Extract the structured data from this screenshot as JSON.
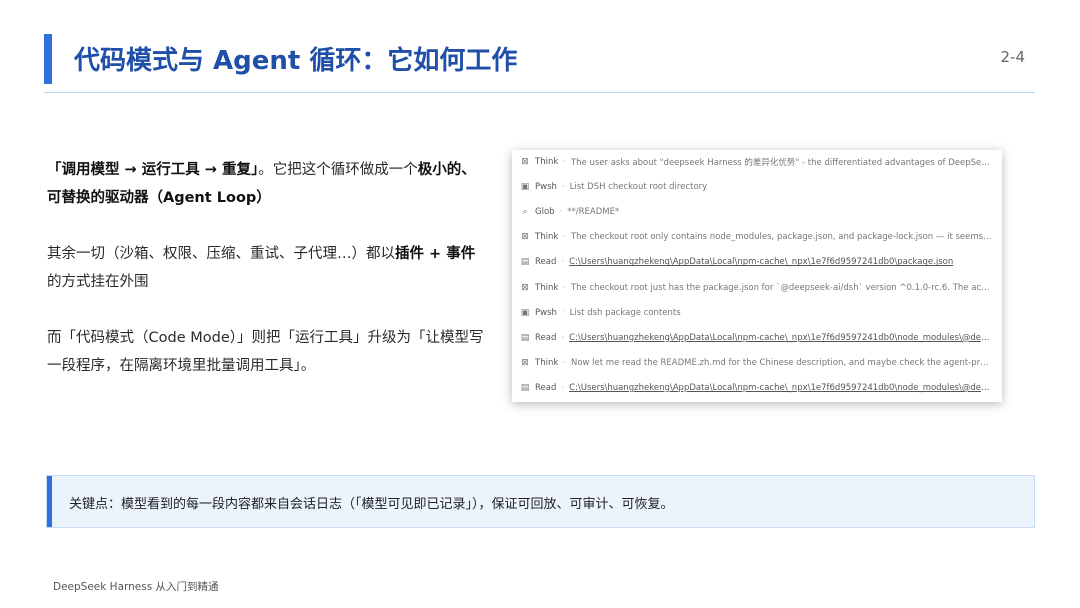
{
  "header": {
    "title": "代码模式与 Agent 循环：它如何工作",
    "page_number": "2-4"
  },
  "left": {
    "p1_bold": "「调用模型 → 运行工具 → 重复」",
    "p1_a": "。它把这个循环做成一个",
    "p1_bold2": "极小的、可替换的驱动器（Agent Loop）",
    "p2_a": "其余一切（沙箱、权限、压缩、重试、子代理…）都以",
    "p2_bold": "插件 + 事件",
    "p2_b": "的方式挂在外围",
    "p3": "而「代码模式（Code Mode）」则把「运行工具」升级为「让模型写一段程序，在隔离环境里批量调用工具」。"
  },
  "log": {
    "rows": [
      {
        "icon": "think-icon",
        "glyph": "⊠",
        "kind": "Think",
        "text": "The user asks about \"deepseek Harness 的差异化优势\" - the differentiated advantages of DeepSeek Harnes...",
        "path": false
      },
      {
        "icon": "terminal-icon",
        "glyph": "▣",
        "kind": "Pwsh",
        "text": "List DSH checkout root directory",
        "path": false
      },
      {
        "icon": "search-icon",
        "glyph": "⌕",
        "kind": "Glob",
        "text": "**/README*",
        "path": false
      },
      {
        "icon": "think-icon",
        "glyph": "⊠",
        "kind": "Think",
        "text": "The checkout root only contains node_modules, package.json, and package-lock.json — it seems the npx ca...",
        "path": false
      },
      {
        "icon": "file-icon",
        "glyph": "▤",
        "kind": "Read",
        "text": "C:\\Users\\huangzhekeng\\AppData\\Local\\npm-cache\\_npx\\1e7f6d9597241db0\\package.json",
        "path": true
      },
      {
        "icon": "think-icon",
        "glyph": "⊠",
        "kind": "Think",
        "text": "The checkout root just has the package.json for `@deepseek-ai/dsh` version ^0.1.0-rc.6. The actual DSH pac...",
        "path": false
      },
      {
        "icon": "terminal-icon",
        "glyph": "▣",
        "kind": "Pwsh",
        "text": "List dsh package contents",
        "path": false
      },
      {
        "icon": "file-icon",
        "glyph": "▤",
        "kind": "Read",
        "text": "C:\\Users\\huangzhekeng\\AppData\\Local\\npm-cache\\_npx\\1e7f6d9597241db0\\node_modules\\@deepseek-ai...",
        "path": true
      },
      {
        "icon": "think-icon",
        "glyph": "⊠",
        "kind": "Think",
        "text": "Now let me read the README.zh.md for the Chinese description, and maybe check the agent-presets confi...",
        "path": false
      },
      {
        "icon": "file-icon",
        "glyph": "▤",
        "kind": "Read",
        "text": "C:\\Users\\huangzhekeng\\AppData\\Local\\npm-cache\\_npx\\1e7f6d9597241db0\\node_modules\\@deepseek-ai...",
        "path": true
      }
    ]
  },
  "callout": {
    "text": "关键点：模型看到的每一段内容都来自会话日志（「模型可见即已记录」），保证可回放、可审计、可恢复。"
  },
  "footer": {
    "text": "DeepSeek Harness 从入门到精通"
  },
  "colors": {
    "accent": "#2f6fe0",
    "title": "#1f4fa8",
    "callout_bg": "#ebf3fd"
  }
}
